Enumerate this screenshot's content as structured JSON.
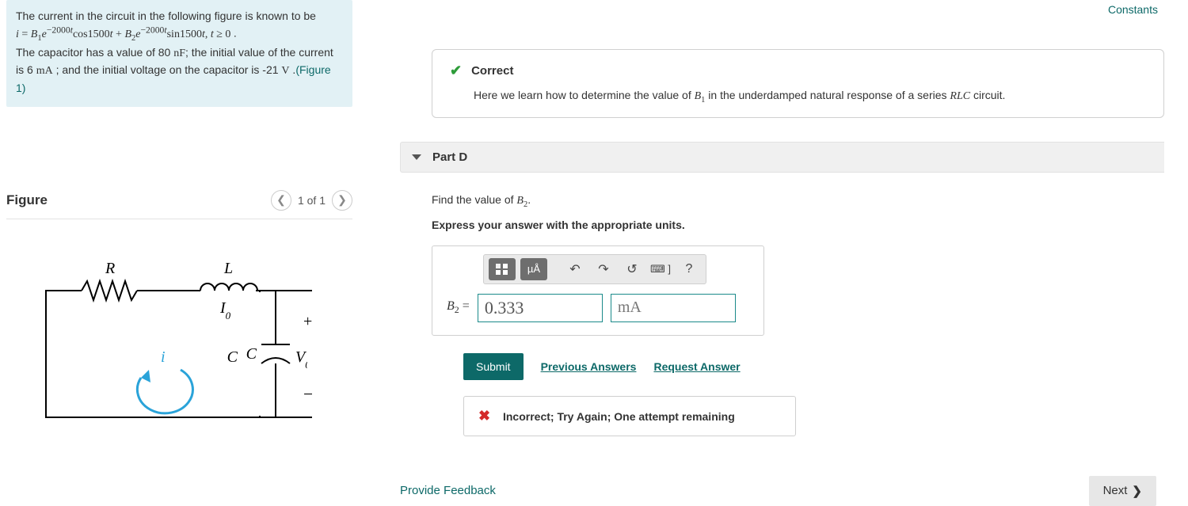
{
  "topnav": {
    "constants": "Constants"
  },
  "problem": {
    "line1": "The current in the circuit in the following figure is known to be",
    "line3a": "The capacitor has a value of 80 ",
    "line3b": "; the initial value of the current is 6 ",
    "line3c": " ; and the initial voltage on the capacitor is -21 ",
    "line3d": " .",
    "figlink": "(Figure 1)",
    "units": {
      "nF": "nF",
      "mA": "mA",
      "V": "V"
    }
  },
  "figure": {
    "title": "Figure",
    "pager": "1 of 1"
  },
  "correct": {
    "title": "Correct",
    "desc_a": "Here we learn how to determine the value of ",
    "desc_b": " in the underdamped natural response of a series ",
    "desc_c": " circuit."
  },
  "part": {
    "label": "Part D"
  },
  "question": {
    "find_a": "Find the value of ",
    "find_b": ".",
    "instr": "Express your answer with the appropriate units."
  },
  "toolbar": {
    "units_btn": "µÅ",
    "help": "?"
  },
  "answer": {
    "var": "B",
    "sub": "2",
    "eq": " = ",
    "value": "0.333",
    "unit": "mA"
  },
  "buttons": {
    "submit": "Submit",
    "prev": "Previous Answers",
    "req": "Request Answer"
  },
  "result": {
    "text": "Incorrect; Try Again; One attempt remaining"
  },
  "footer": {
    "feedback": "Provide Feedback",
    "next": "Next"
  }
}
